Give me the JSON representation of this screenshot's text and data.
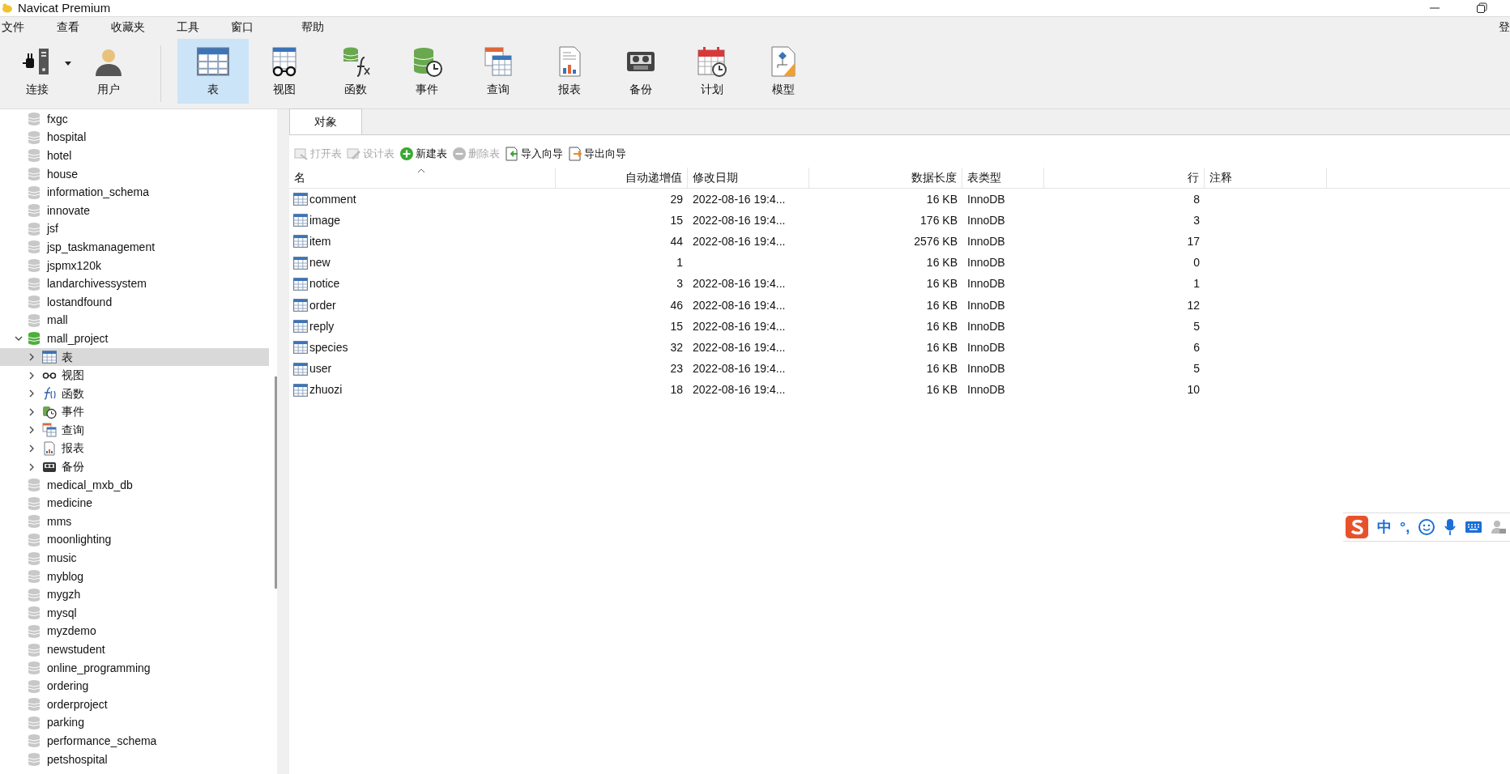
{
  "window": {
    "title": "Navicat Premium"
  },
  "menu": [
    "文件",
    "查看",
    "收藏夹",
    "工具",
    "窗口",
    "帮助"
  ],
  "login": "登",
  "toolbar": [
    {
      "kind": "connect",
      "label": "连接",
      "selected": false
    },
    {
      "kind": "user",
      "label": "用户",
      "selected": false
    },
    {
      "kind": "table",
      "label": "表",
      "selected": true
    },
    {
      "kind": "view",
      "label": "视图",
      "selected": false
    },
    {
      "kind": "function",
      "label": "函数",
      "selected": false
    },
    {
      "kind": "event",
      "label": "事件",
      "selected": false
    },
    {
      "kind": "query",
      "label": "查询",
      "selected": false
    },
    {
      "kind": "report",
      "label": "报表",
      "selected": false
    },
    {
      "kind": "backup",
      "label": "备份",
      "selected": false
    },
    {
      "kind": "schedule",
      "label": "计划",
      "selected": false
    },
    {
      "kind": "model",
      "label": "模型",
      "selected": false
    }
  ],
  "sidebar": {
    "items": [
      {
        "label": "fxgc",
        "open": false
      },
      {
        "label": "hospital",
        "open": false
      },
      {
        "label": "hotel",
        "open": false
      },
      {
        "label": "house",
        "open": false
      },
      {
        "label": "information_schema",
        "open": false
      },
      {
        "label": "innovate",
        "open": false
      },
      {
        "label": "jsf",
        "open": false
      },
      {
        "label": "jsp_taskmanagement",
        "open": false
      },
      {
        "label": "jspmx120k",
        "open": false
      },
      {
        "label": "landarchivessystem",
        "open": false
      },
      {
        "label": "lostandfound",
        "open": false
      },
      {
        "label": "mall",
        "open": false
      },
      {
        "label": "mall_project",
        "open": true,
        "children": [
          {
            "kind": "table",
            "label": "表",
            "expanded": false,
            "selected": true
          },
          {
            "kind": "view",
            "label": "视图",
            "expanded": false,
            "selected": false
          },
          {
            "kind": "function",
            "label": "函数",
            "expanded": false,
            "selected": false
          },
          {
            "kind": "event",
            "label": "事件",
            "expanded": false,
            "selected": false
          },
          {
            "kind": "query",
            "label": "查询",
            "expanded": false,
            "selected": false
          },
          {
            "kind": "report",
            "label": "报表",
            "expanded": false,
            "selected": false
          },
          {
            "kind": "backup",
            "label": "备份",
            "expanded": false,
            "selected": false
          }
        ]
      },
      {
        "label": "medical_mxb_db",
        "open": false
      },
      {
        "label": "medicine",
        "open": false
      },
      {
        "label": "mms",
        "open": false
      },
      {
        "label": "moonlighting",
        "open": false
      },
      {
        "label": "music",
        "open": false
      },
      {
        "label": "myblog",
        "open": false
      },
      {
        "label": "mygzh",
        "open": false
      },
      {
        "label": "mysql",
        "open": false
      },
      {
        "label": "myzdemo",
        "open": false
      },
      {
        "label": "newstudent",
        "open": false
      },
      {
        "label": "online_programming",
        "open": false
      },
      {
        "label": "ordering",
        "open": false
      },
      {
        "label": "orderproject",
        "open": false
      },
      {
        "label": "parking",
        "open": false
      },
      {
        "label": "performance_schema",
        "open": false
      },
      {
        "label": "petshospital",
        "open": false
      }
    ]
  },
  "tabs": [
    {
      "label": "对象",
      "selected": true
    }
  ],
  "actions": [
    {
      "kind": "open",
      "label": "打开表",
      "disabled": true
    },
    {
      "kind": "design",
      "label": "设计表",
      "disabled": true
    },
    {
      "kind": "new",
      "label": "新建表",
      "disabled": false
    },
    {
      "kind": "delete",
      "label": "删除表",
      "disabled": true
    },
    {
      "kind": "import",
      "label": "导入向导",
      "disabled": false
    },
    {
      "kind": "export",
      "label": "导出向导",
      "disabled": false
    }
  ],
  "table": {
    "columns": [
      "名",
      "自动递增值",
      "修改日期",
      "数据长度",
      "表类型",
      "行",
      "注释"
    ],
    "rows": [
      {
        "name": "comment",
        "auto_increment": "29",
        "modified": "2022-08-16 19:4...",
        "data_length": "16 KB",
        "engine": "InnoDB",
        "rows": "8"
      },
      {
        "name": "image",
        "auto_increment": "15",
        "modified": "2022-08-16 19:4...",
        "data_length": "176 KB",
        "engine": "InnoDB",
        "rows": "3"
      },
      {
        "name": "item",
        "auto_increment": "44",
        "modified": "2022-08-16 19:4...",
        "data_length": "2576 KB",
        "engine": "InnoDB",
        "rows": "17"
      },
      {
        "name": "new",
        "auto_increment": "1",
        "data_length": "16 KB",
        "engine": "InnoDB",
        "rows": "0"
      },
      {
        "name": "notice",
        "auto_increment": "3",
        "modified": "2022-08-16 19:4...",
        "data_length": "16 KB",
        "engine": "InnoDB",
        "rows": "1"
      },
      {
        "name": "order",
        "auto_increment": "46",
        "modified": "2022-08-16 19:4...",
        "data_length": "16 KB",
        "engine": "InnoDB",
        "rows": "12"
      },
      {
        "name": "reply",
        "auto_increment": "15",
        "modified": "2022-08-16 19:4...",
        "data_length": "16 KB",
        "engine": "InnoDB",
        "rows": "5"
      },
      {
        "name": "species",
        "auto_increment": "32",
        "modified": "2022-08-16 19:4...",
        "data_length": "16 KB",
        "engine": "InnoDB",
        "rows": "6"
      },
      {
        "name": "user",
        "auto_increment": "23",
        "modified": "2022-08-16 19:4...",
        "data_length": "16 KB",
        "engine": "InnoDB",
        "rows": "5"
      },
      {
        "name": "zhuozi",
        "auto_increment": "18",
        "modified": "2022-08-16 19:4...",
        "data_length": "16 KB",
        "engine": "InnoDB",
        "rows": "10"
      }
    ]
  },
  "ime_bar": {
    "items": [
      {
        "kind": "logo"
      },
      {
        "kind": "text",
        "label": "中"
      },
      {
        "kind": "text",
        "label": "°,"
      },
      {
        "kind": "emoji"
      },
      {
        "kind": "mic"
      },
      {
        "kind": "keyboard"
      },
      {
        "kind": "user"
      }
    ]
  }
}
